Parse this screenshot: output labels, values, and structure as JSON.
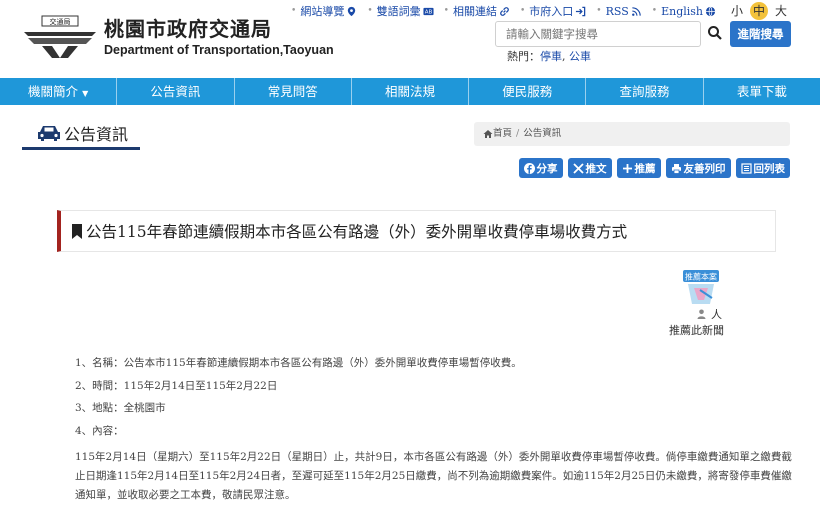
{
  "header": {
    "logo_badge": "交通局",
    "org_name_zh": "桃園市政府交通局",
    "org_name_en": "Department of Transportation,Taoyuan"
  },
  "toplinks": [
    {
      "label": "網站導覽",
      "icon": "map-marker-icon"
    },
    {
      "label": "雙語詞彙",
      "icon": "ab-icon"
    },
    {
      "label": "相關連結",
      "icon": "link-icon"
    },
    {
      "label": "市府入口",
      "icon": "enter-icon"
    },
    {
      "label": "RSS",
      "icon": "rss-icon"
    },
    {
      "label": "English",
      "icon": "globe-icon"
    }
  ],
  "font_size": {
    "small": "小",
    "medium": "中",
    "large": "大"
  },
  "search": {
    "placeholder": "請輸入關鍵字搜尋",
    "advanced_label": "進階搜尋",
    "hot_label": "熱門：",
    "hot_links": [
      "停車",
      "公車"
    ],
    "hot_sep": ", "
  },
  "nav": [
    {
      "label": "機關簡介",
      "dropdown": true
    },
    {
      "label": "公告資訊"
    },
    {
      "label": "常見問答"
    },
    {
      "label": "相關法規"
    },
    {
      "label": "便民服務"
    },
    {
      "label": "查詢服務"
    },
    {
      "label": "表單下載"
    }
  ],
  "page": {
    "title": "公告資訊"
  },
  "breadcrumb": {
    "home": "首頁",
    "current": "公告資訊",
    "sep": "/"
  },
  "tools": [
    {
      "label": "分享",
      "icon": "facebook-icon"
    },
    {
      "label": "推文",
      "icon": "x-icon"
    },
    {
      "label": "推薦",
      "icon": "plus-icon"
    },
    {
      "label": "友善列印",
      "icon": "print-icon"
    },
    {
      "label": "回列表",
      "icon": "list-icon"
    }
  ],
  "article": {
    "title": "公告115年春節連續假期本市各區公有路邊（外）委外開單收費停車場收費方式",
    "recommend_count": "人",
    "recommend_label": "推薦此新聞",
    "recommend_badge": "推薦本案",
    "items": [
      "1、名稱：公告本市115年春節連續假期本市各區公有路邊（外）委外開單收費停車場暫停收費。",
      "2、時間：115年2月14日至115年2月22日",
      "3、地點：全桃園市",
      "4、內容："
    ],
    "paragraph": "115年2月14日（星期六）至115年2月22日（星期日）止，共計9日，本市各區公有路邊（外）委外開單收費停車場暫停收費。倘停車繳費通知單之繳費截止日期逢115年2月14日至115年2月24日者，至遲可延至115年2月25日繳費，尚不列為逾期繳費案件。如逾115年2月25日仍未繳費，將寄發停車費催繳通知單，並收取必要之工本費，敬請民眾注意。"
  },
  "colors": {
    "nav": "#1f97d9",
    "button": "#2b74c9",
    "accent": "#a3231f",
    "title_underline": "#1c3a6e",
    "font_active": "#f3c23b"
  }
}
